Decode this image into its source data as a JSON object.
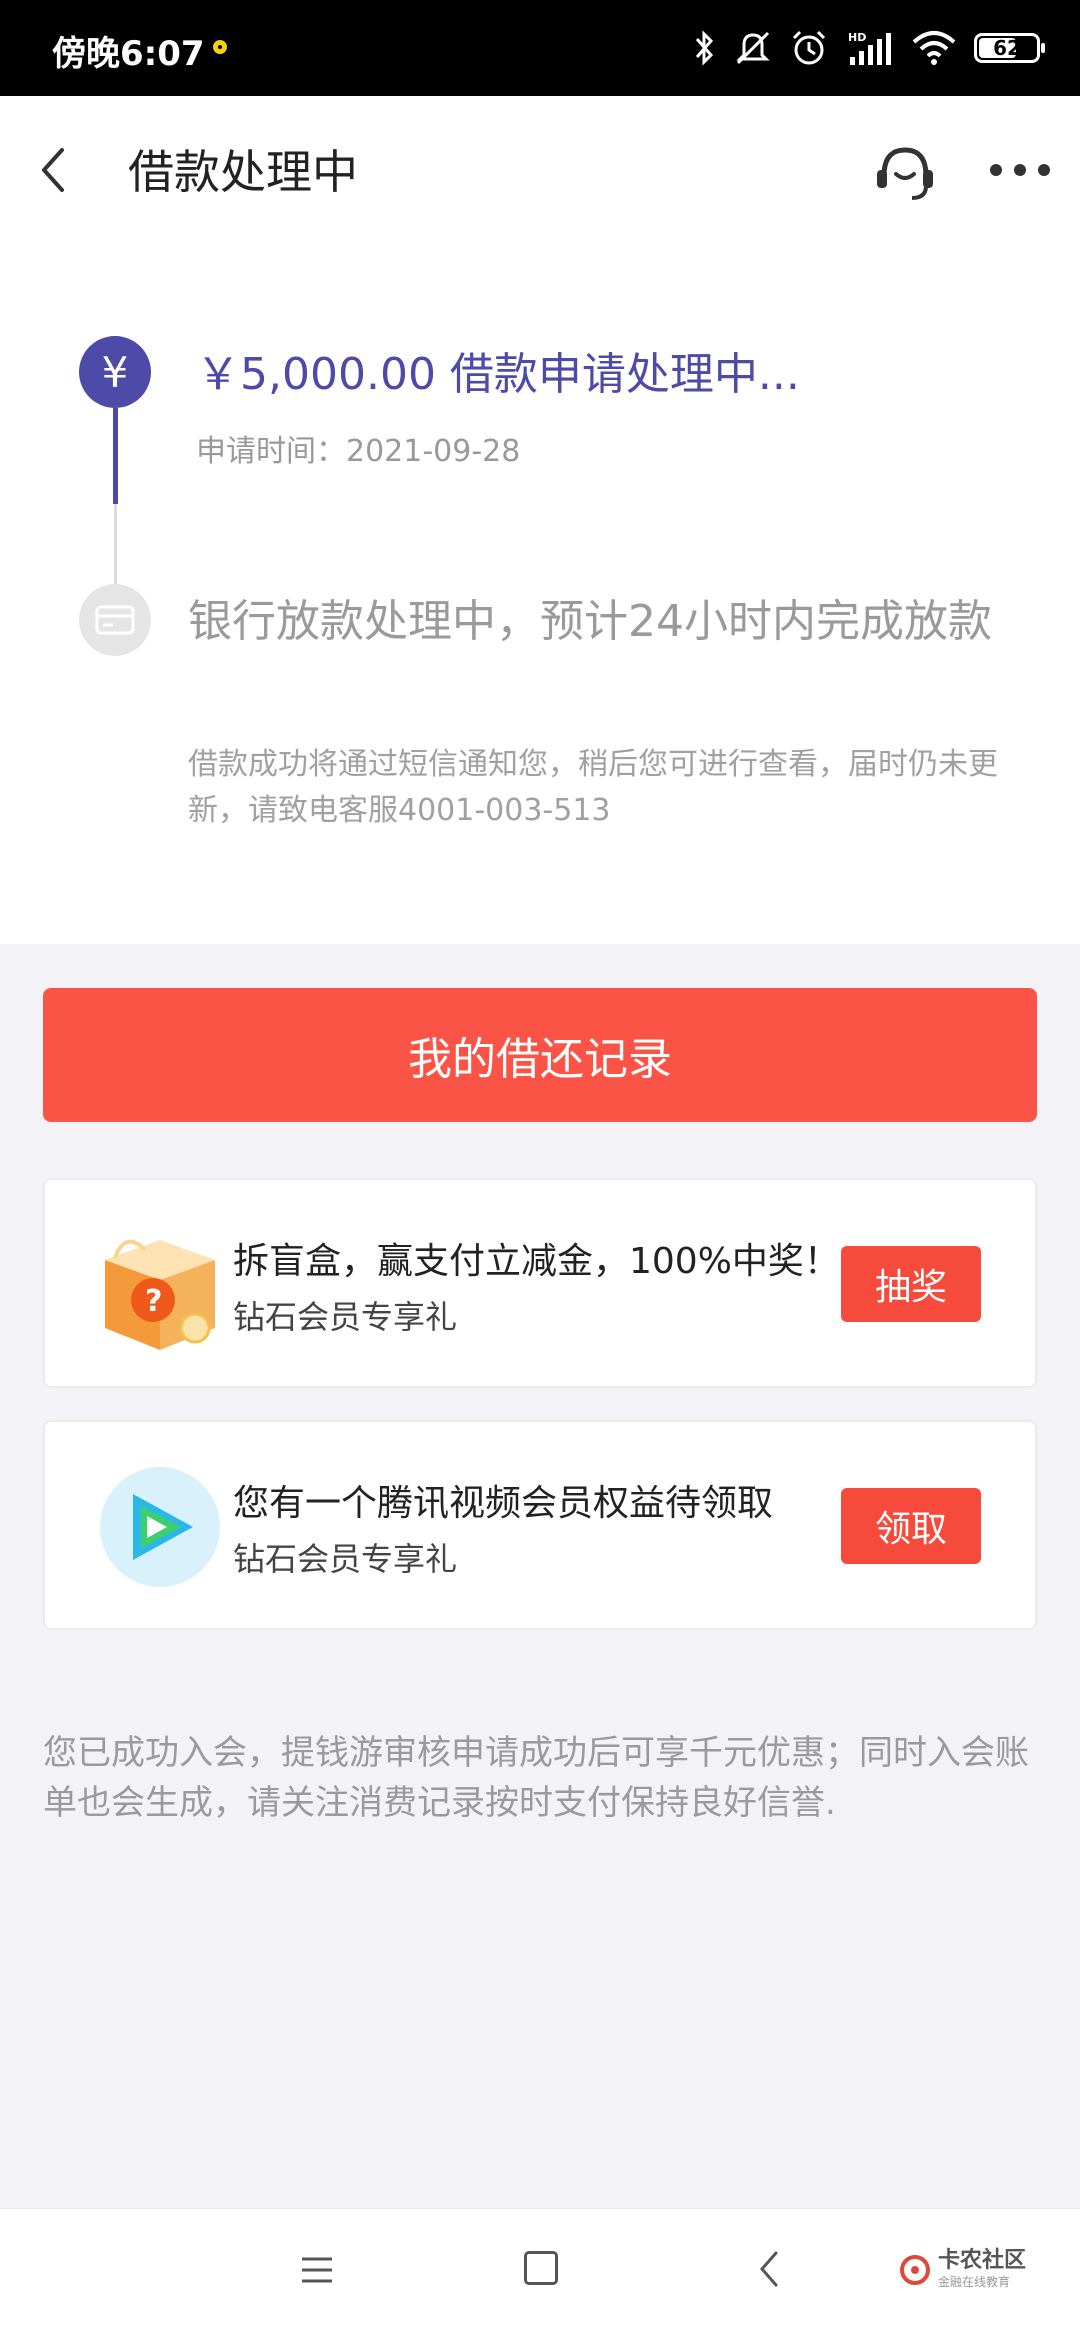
{
  "status_bar": {
    "time": "傍晚6:07",
    "battery": "62",
    "icons": [
      "bluetooth-icon",
      "mute-icon",
      "alarm-icon",
      "hd-signal-icon",
      "wifi-icon",
      "battery-icon"
    ]
  },
  "header": {
    "title": "借款处理中",
    "back_icon": "back-arrow-icon",
    "service_icon": "customer-service-icon",
    "more_icon": "more-icon"
  },
  "status": {
    "step1": {
      "icon_symbol": "¥",
      "title": "￥5,000.00 借款申请处理中...",
      "time": "申请时间：2021-09-28"
    },
    "step2": {
      "icon": "card-icon",
      "title": "银行放款处理中，预计24小时内完成放款",
      "desc": "借款成功将通过短信通知您，稍后您可进行查看，届时仍未更新，请致电客服4001-003-513"
    }
  },
  "primary_button": "我的借还记录",
  "promos": [
    {
      "icon": "blind-box-icon",
      "title": "拆盲盒，赢支付立减金，100%中奖！",
      "subtitle": "钻石会员专享礼",
      "button": "抽奖"
    },
    {
      "icon": "tencent-video-icon",
      "title": "您有一个腾讯视频会员权益待领取",
      "subtitle": "钻石会员专享礼",
      "button": "领取"
    }
  ],
  "footnote": "您已成功入会，提钱游审核申请成功后可享千元优惠；同时入会账单也会生成，请关注消费记录按时支付保持良好信誉.",
  "nav": {
    "icons": [
      "menu-icon",
      "home-icon",
      "back-icon"
    ],
    "watermark": "卡农社区",
    "watermark_sub": "金融在线教育"
  },
  "colors": {
    "accent": "#4e4aa8",
    "primary_red": "#fb5346",
    "promo_red": "#f54a3c",
    "muted": "#9a9a9a"
  }
}
